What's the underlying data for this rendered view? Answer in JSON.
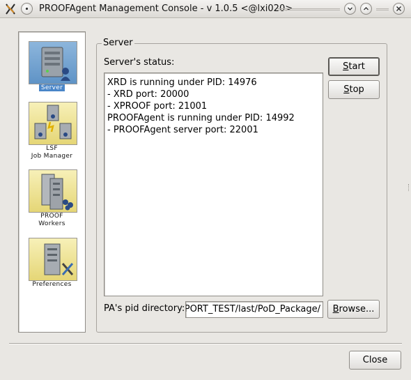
{
  "window": {
    "title": "PROOFAgent Management Console - v 1.0.5 <@lxi020>",
    "menu_icon": "dot-menu-icon",
    "minimize_icon": "chevron-down-icon",
    "maximize_icon": "chevron-up-icon",
    "close_icon": "close-icon"
  },
  "sidebar": {
    "items": [
      {
        "label_lines": [
          "Server"
        ],
        "icon": "server-icon",
        "selected": true
      },
      {
        "label_lines": [
          "LSF",
          "Job Manager"
        ],
        "icon": "lsf-job-manager-icon",
        "selected": false
      },
      {
        "label_lines": [
          "PROOF",
          "Workers"
        ],
        "icon": "proof-workers-icon",
        "selected": false
      },
      {
        "label_lines": [
          "Preferences"
        ],
        "icon": "preferences-icon",
        "selected": false
      }
    ]
  },
  "server": {
    "group_title": "Server",
    "status_label": "Server's status:",
    "status_lines": [
      "XRD is running under PID: 14976",
      "- XRD port: 20000",
      "- XPROOF port: 21001",
      "PROOFAgent is running under PID: 14992",
      "- PROOFAgent server port: 22001"
    ],
    "start_button": {
      "mnemonic": "S",
      "rest": "tart"
    },
    "stop_button": {
      "mnemonic": "S",
      "rest": "top"
    },
    "pid_dir_label": "PA's pid directory:",
    "pid_dir_value": "PORT_TEST/last/PoD_Package/",
    "browse_button": {
      "mnemonic": "B",
      "rest": "rowse..."
    }
  },
  "footer": {
    "close_button": "Close"
  },
  "colors": {
    "selection": "#4a86c8",
    "window_bg": "#e9e7e3"
  }
}
